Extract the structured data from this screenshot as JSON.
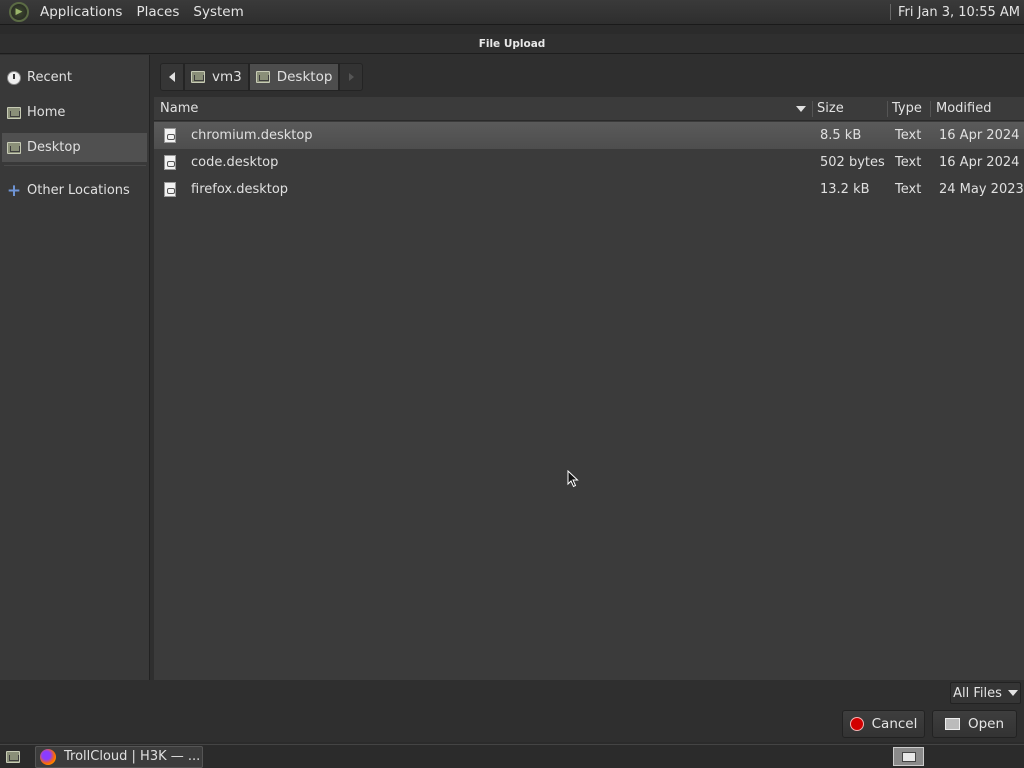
{
  "top_panel": {
    "menus": [
      "Applications",
      "Places",
      "System"
    ],
    "clock": "Fri Jan  3, 10:55 AM"
  },
  "dialog": {
    "title": "File Upload",
    "sidebar": {
      "items": [
        {
          "label": "Recent",
          "icon": "clock-icon"
        },
        {
          "label": "Home",
          "icon": "home-folder-icon"
        },
        {
          "label": "Desktop",
          "icon": "desktop-folder-icon",
          "active": true
        },
        {
          "label": "Other Locations",
          "icon": "plus-icon"
        }
      ]
    },
    "pathbar": {
      "crumbs": [
        "vm3",
        "Desktop"
      ],
      "current": "Desktop"
    },
    "columns": {
      "name": "Name",
      "size": "Size",
      "type": "Type",
      "modified": "Modified"
    },
    "files": [
      {
        "name": "chromium.desktop",
        "size": "8.5 kB",
        "type": "Text",
        "modified": "16 Apr 2024",
        "selected": true
      },
      {
        "name": "code.desktop",
        "size": "502 bytes",
        "type": "Text",
        "modified": "16 Apr 2024"
      },
      {
        "name": "firefox.desktop",
        "size": "13.2 kB",
        "type": "Text",
        "modified": "24 May 2023"
      }
    ],
    "filter": "All Files",
    "buttons": {
      "cancel": "Cancel",
      "open": "Open"
    }
  },
  "taskbar": {
    "window_title": "TrollCloud | H3K — ..."
  }
}
